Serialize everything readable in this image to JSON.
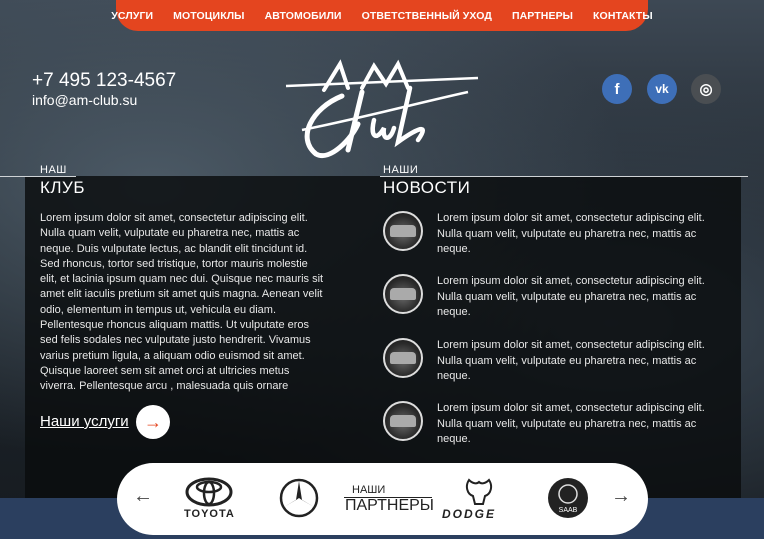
{
  "nav": {
    "items": [
      "УСЛУГИ",
      "МОТОЦИКЛЫ",
      "АВТОМОБИЛИ",
      "ОТВЕТСТВЕННЫЙ УХОД",
      "ПАРТНЕРЫ",
      "КОНТАКТЫ"
    ]
  },
  "header": {
    "phone": "+7 495 123-4567",
    "email": "info@am-club.su",
    "logo_text": "AM club"
  },
  "social": {
    "icons": [
      "facebook-icon",
      "vk-icon",
      "instagram-icon"
    ],
    "fb_glyph": "f",
    "vk_glyph": "vk",
    "ig_glyph": "◎"
  },
  "club": {
    "subtitle": "НАШ",
    "title": "КЛУБ",
    "text": "Lorem ipsum dolor sit amet, consectetur adipiscing elit. Nulla quam velit, vulputate eu pharetra nec, mattis ac neque. Duis vulputate lectus, ac blandit elit tincidunt id. Sed rhoncus, tortor sed tristique, tortor mauris molestie elit, et lacinia ipsum quam nec dui. Quisque nec mauris sit amet elit iaculis pretium sit amet quis magna. Aenean velit odio, elementum in tempus ut, vehicula eu diam. Pellentesque rhoncus aliquam mattis. Ut vulputate eros sed felis sodales nec vulputate justo hendrerit. Vivamus varius pretium ligula, a aliquam odio euismod sit amet. Quisque laoreet sem sit amet orci at ultricies metus viverra. Pellentesque arcu , malesuada quis ornare",
    "services_link": "Наши услуги",
    "arrow_glyph": "→"
  },
  "news": {
    "subtitle": "НАШИ",
    "title": "НОВОСТИ",
    "items": [
      "Lorem ipsum dolor sit amet, consectetur adipiscing elit. Nulla quam velit, vulputate eu pharetra nec, mattis ac neque.",
      "Lorem ipsum dolor sit amet, consectetur adipiscing elit. Nulla quam velit, vulputate eu pharetra nec, mattis ac neque.",
      "Lorem ipsum dolor sit amet, consectetur adipiscing elit. Nulla quam velit, vulputate eu pharetra nec, mattis ac neque.",
      "Lorem ipsum dolor sit amet, consectetur adipiscing elit. Nulla quam velit, vulputate eu pharetra nec, mattis ac neque."
    ]
  },
  "partners": {
    "subtitle": "НАШИ",
    "title": "ПАРТНЕРЫ",
    "prev_glyph": "←",
    "next_glyph": "→",
    "brands": [
      "TOYOTA",
      "Mercedes-Benz",
      "DODGE",
      "SAAB"
    ],
    "toyota_label": "TOYOTA",
    "dodge_label": "DODGE",
    "saab_label": "SAAB"
  },
  "colors": {
    "accent": "#e4451f",
    "social_blue": "#3e6fb8",
    "panel": "#0a0c0e"
  }
}
